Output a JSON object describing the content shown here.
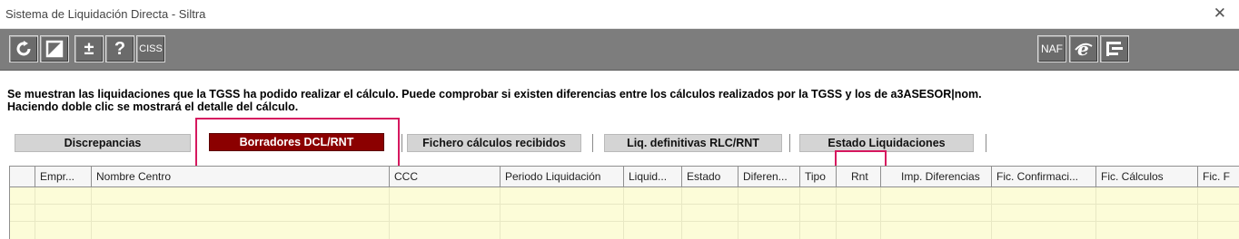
{
  "window": {
    "title": "Sistema de Liquidación Directa - Siltra",
    "close_glyph": "✕"
  },
  "toolbar": {
    "left_buttons": [
      {
        "icon": "refresh-icon"
      },
      {
        "icon": "edit-square-icon"
      },
      {
        "label": "±",
        "icon": "plus-minus-icon"
      },
      {
        "label": "?",
        "icon": "help-icon"
      },
      {
        "label": "CISS",
        "icon": "ciss-icon"
      }
    ],
    "right_buttons": [
      {
        "label": "NAF",
        "icon": "naf-icon"
      },
      {
        "icon": "internet-explorer-icon"
      },
      {
        "icon": "exit-icon"
      }
    ]
  },
  "info": {
    "line1": "Se muestran las liquidaciones que la TGSS ha podido realizar el cálculo. Puede comprobar si existen diferencias entre los cálculos realizados por la TGSS y los de a3ASESOR|nom.",
    "line2": "Haciendo doble clic se mostrará el detalle del cálculo."
  },
  "tabs": [
    {
      "label": "Discrepancias",
      "active": false
    },
    {
      "label": "Borradores DCL/RNT",
      "active": true
    },
    {
      "label": "Fichero cálculos recibidos",
      "active": false
    },
    {
      "label": "Liq. definitivas RLC/RNT",
      "active": false
    },
    {
      "label": "Estado Liquidaciones",
      "active": false
    }
  ],
  "table": {
    "columns": [
      "Empr...",
      "Nombre Centro",
      "CCC",
      "Periodo Liquidación",
      "Liquid...",
      "Estado",
      "Diferen...",
      "Tipo",
      "Rnt",
      "Imp. Diferencias",
      "Fic. Confirmaci...",
      "Fic. Cálculos",
      "Fic. F"
    ],
    "rows": []
  },
  "colors": {
    "toolbar_bg": "#7d7d7d",
    "active_tab_bg": "#8b0000",
    "highlight": "#d6185f",
    "grid_body_bg": "#fcfcd8"
  }
}
